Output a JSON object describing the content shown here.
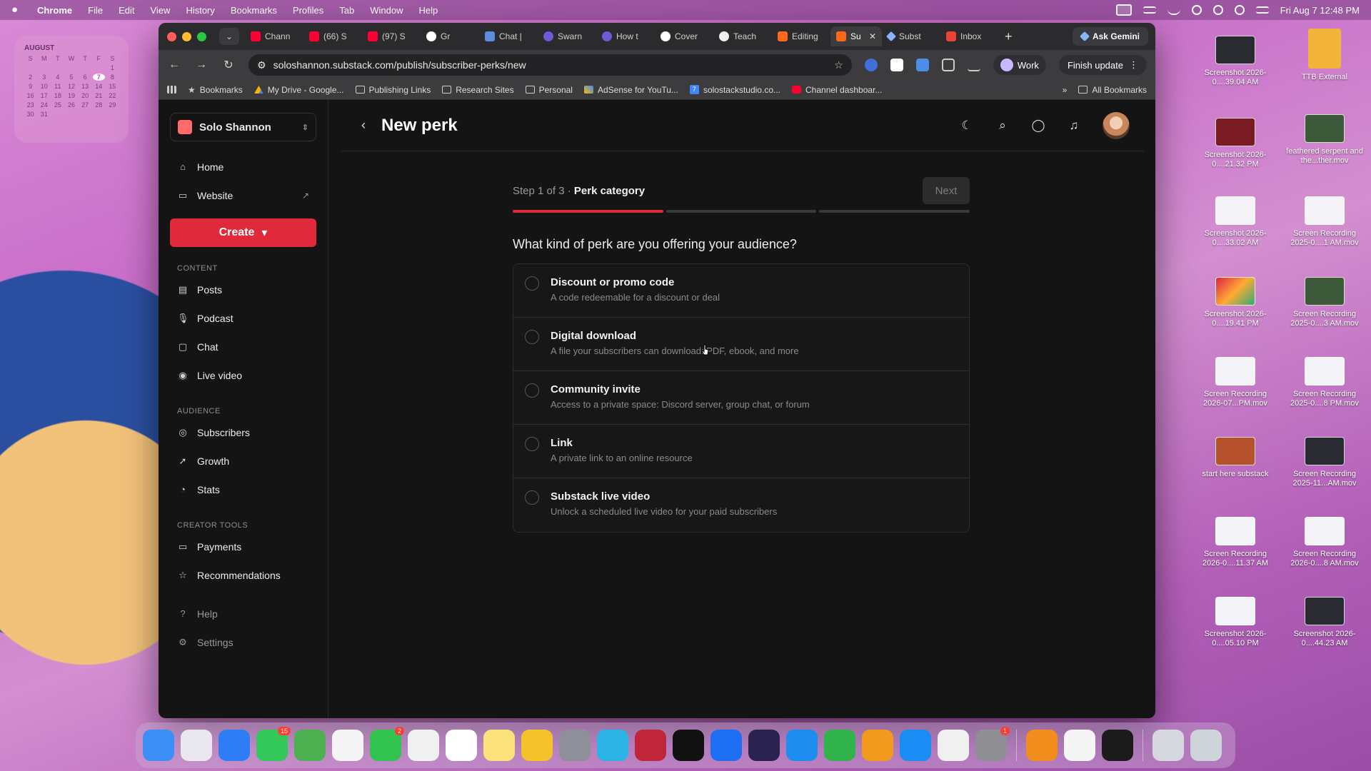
{
  "menubar": {
    "app": "Chrome",
    "items": [
      "File",
      "Edit",
      "View",
      "History",
      "Bookmarks",
      "Profiles",
      "Tab",
      "Window",
      "Help"
    ],
    "clock": "Fri Aug 7  12:48 PM"
  },
  "calendar": {
    "month": "AUGUST",
    "weekdays": [
      "S",
      "M",
      "T",
      "W",
      "T",
      "F",
      "S"
    ],
    "days": [
      "",
      "",
      "",
      "",
      "",
      "",
      "1",
      "2",
      "3",
      "4",
      "5",
      "6",
      "7",
      "8",
      "9",
      "10",
      "11",
      "12",
      "13",
      "14",
      "15",
      "16",
      "17",
      "18",
      "19",
      "20",
      "21",
      "22",
      "23",
      "24",
      "25",
      "26",
      "27",
      "28",
      "29",
      "30",
      "31"
    ],
    "today": "7"
  },
  "desktop_icons": [
    {
      "label": "Screenshot 2026-0....39.04 AM",
      "thumb": "dark"
    },
    {
      "label": "TTB External",
      "thumb": "folder"
    },
    {
      "label": "Screenshot 2026-0....21.32 PM",
      "thumb": "red"
    },
    {
      "label": "feathered serpent and the...ther.mov",
      "thumb": "green"
    },
    {
      "label": "Screenshot 2026-0....33.02 AM",
      "thumb": "light"
    },
    {
      "label": "Screen Recording 2025-0....1 AM.mov",
      "thumb": "light"
    },
    {
      "label": "Screenshot 2026-0....19.41 PM",
      "thumb": "multi"
    },
    {
      "label": "Screen Recording 2025-0....3 AM.mov",
      "thumb": "green"
    },
    {
      "label": "Screen Recording 2026-07...PM.mov",
      "thumb": "light"
    },
    {
      "label": "Screen Recording 2025-0....8 PM.mov",
      "thumb": "light"
    },
    {
      "label": "start here substack",
      "thumb": "orange"
    },
    {
      "label": "Screen Recording 2025-11...AM.mov",
      "thumb": "dark"
    },
    {
      "label": "Screen Recording 2026-0....11.37 AM",
      "thumb": "light"
    },
    {
      "label": "Screen Recording 2026-0....8 AM.mov",
      "thumb": "light"
    },
    {
      "label": "Screenshot 2026-0....05.10 PM",
      "thumb": "light"
    },
    {
      "label": "Screenshot 2026-0....44.23 AM",
      "thumb": "dark"
    }
  ],
  "browser": {
    "tabs": [
      {
        "label": "Chann",
        "fav": "yt"
      },
      {
        "label": "(66) S",
        "fav": "yt"
      },
      {
        "label": "(97) S",
        "fav": "yt"
      },
      {
        "label": "Gr",
        "fav": "chat"
      },
      {
        "label": "Chat |",
        "fav": "iq"
      },
      {
        "label": "Swarn",
        "fav": "swarm"
      },
      {
        "label": "How t",
        "fav": "swarm"
      },
      {
        "label": "Cover",
        "fav": "canva"
      },
      {
        "label": "Teach",
        "fav": "teach"
      },
      {
        "label": "Editing",
        "fav": "sub"
      },
      {
        "label": "Su",
        "fav": "sub",
        "active": true
      },
      {
        "label": "Subst",
        "fav": "gem"
      },
      {
        "label": "Inbox",
        "fav": "gmail"
      }
    ],
    "new_tab": "+",
    "ask_gemini": "Ask Gemini",
    "url": "soloshannon.substack.com/publish/subscriber-perks/new",
    "profile": "Work",
    "finish_update": "Finish update",
    "bookmarks": [
      {
        "label": "Bookmarks",
        "icon": "star"
      },
      {
        "label": "My Drive - Google...",
        "icon": "drive"
      },
      {
        "label": "Publishing Links",
        "icon": "folder"
      },
      {
        "label": "Research Sites",
        "icon": "folder"
      },
      {
        "label": "Personal",
        "icon": "folder"
      },
      {
        "label": "AdSense for YouTu...",
        "icon": "ads"
      },
      {
        "label": "solostackstudio.co...",
        "icon": "num"
      },
      {
        "label": "Channel dashboar...",
        "icon": "yt"
      }
    ],
    "bookmarks_more": "»",
    "all_bookmarks": "All Bookmarks"
  },
  "sidebar": {
    "publication": "Solo Shannon",
    "top_items": [
      {
        "label": "Home",
        "icon": "⌂"
      },
      {
        "label": "Website",
        "icon": "▭"
      }
    ],
    "create": "Create",
    "sections": [
      {
        "label": "CONTENT",
        "items": [
          {
            "label": "Posts",
            "icon": "▤"
          },
          {
            "label": "Podcast",
            "icon": "🎙"
          },
          {
            "label": "Chat",
            "icon": "▢"
          },
          {
            "label": "Live video",
            "icon": "◉"
          }
        ]
      },
      {
        "label": "AUDIENCE",
        "items": [
          {
            "label": "Subscribers",
            "icon": "◎"
          },
          {
            "label": "Growth",
            "icon": "➚"
          },
          {
            "label": "Stats",
            "icon": "◔"
          }
        ]
      },
      {
        "label": "CREATOR TOOLS",
        "items": [
          {
            "label": "Payments",
            "icon": "▭"
          },
          {
            "label": "Recommendations",
            "icon": "☆"
          }
        ]
      }
    ],
    "bottom_items": [
      {
        "label": "Help",
        "icon": "?"
      },
      {
        "label": "Settings",
        "icon": "⚙"
      }
    ]
  },
  "header": {
    "title": "New perk"
  },
  "wizard": {
    "step_prefix": "Step 1 of 3 · ",
    "step_name": "Perk category",
    "next": "Next",
    "progress": {
      "current": 1,
      "total": 3
    },
    "question": "What kind of perk are you offering your audience?",
    "options": [
      {
        "title": "Discount or promo code",
        "desc": "A code redeemable for a discount or deal"
      },
      {
        "title": "Digital download",
        "desc": "A file your subscribers can download: PDF, ebook, and more"
      },
      {
        "title": "Community invite",
        "desc": "Access to a private space: Discord server, group chat, or forum"
      },
      {
        "title": "Link",
        "desc": "A private link to an online resource"
      },
      {
        "title": "Substack live video",
        "desc": "Unlock a scheduled live video for your paid subscribers"
      }
    ]
  },
  "dock": {
    "apps": [
      {
        "name": "finder",
        "color": "#3a8ef6"
      },
      {
        "name": "launchpad",
        "color": "#e8e8ee"
      },
      {
        "name": "safari",
        "color": "#2f7df6"
      },
      {
        "name": "messages",
        "color": "#34c759",
        "badge": "15"
      },
      {
        "name": "maps",
        "color": "#4cb050"
      },
      {
        "name": "photos",
        "color": "#f5f5f5"
      },
      {
        "name": "facetime",
        "color": "#32c350",
        "badge": "2"
      },
      {
        "name": "chrome",
        "color": "#f0f0f0"
      },
      {
        "name": "calendar",
        "color": "#ffffff"
      },
      {
        "name": "notes",
        "color": "#fbe27a"
      },
      {
        "name": "tes",
        "color": "#f4c22b"
      },
      {
        "name": "rocket",
        "color": "#8f8f99"
      },
      {
        "name": "canva",
        "color": "#2bb3e6"
      },
      {
        "name": "scrivener",
        "color": "#c0263a"
      },
      {
        "name": "freeform",
        "color": "#111111"
      },
      {
        "name": "quicktime",
        "color": "#1d6ef2"
      },
      {
        "name": "nightsky",
        "color": "#2a2350"
      },
      {
        "name": "keynote",
        "color": "#1d8df0"
      },
      {
        "name": "numbers",
        "color": "#2fb34a"
      },
      {
        "name": "pages",
        "color": "#f29a1e"
      },
      {
        "name": "appstore",
        "color": "#1a8df5"
      },
      {
        "name": "drive",
        "color": "#f0f0f0"
      },
      {
        "name": "settings",
        "color": "#8e8e93",
        "badge": "1"
      },
      {
        "name": "books",
        "color": "#f28c1c"
      },
      {
        "name": "textedit",
        "color": "#f5f5f5"
      },
      {
        "name": "penapp",
        "color": "#1b1b1b"
      },
      {
        "name": "stack",
        "color": "#d8d8e0"
      },
      {
        "name": "trash",
        "color": "#cfd3da"
      }
    ]
  }
}
